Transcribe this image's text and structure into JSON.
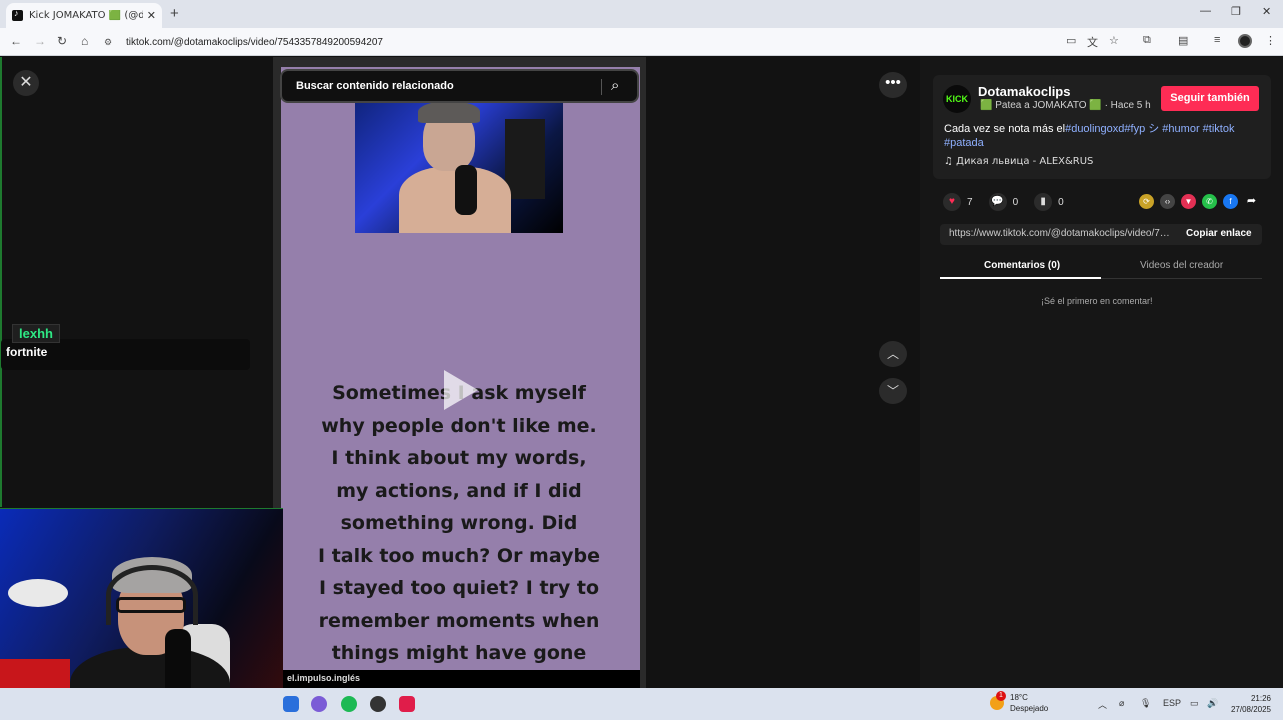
{
  "browser": {
    "tab_title": "Kick JOMAKATO 🟩 (@dota",
    "url": "tiktok.com/@dotamakoclips/video/7543357849200594207"
  },
  "video": {
    "search_placeholder": "Buscar contenido relacionado",
    "text": "Sometimes I ask myself\nwhy people don't like me.\nI think about my words,\nmy actions, and if I did\nsomething wrong. Did\nI talk too much? Or maybe\nI stayed too quiet? I try to\nremember moments when\nthings might have gone",
    "watermark": "el.impulso.inglés"
  },
  "overlay_chat": {
    "user": "lexhh",
    "message": "fortnite"
  },
  "creator": {
    "logo_text": "KICK",
    "name": "Dotamakoclips",
    "subtitle": "🟩 Patea a JOMAKATO 🟩 · Hace 5 h",
    "follow_label": "Seguir también",
    "caption_prefix": "Cada vez se nota más el",
    "caption_tags": "#duolingoxd#fyp シ #humor #tiktok #patada",
    "music": "Дикая львица - ALEX&RUS"
  },
  "stats": {
    "likes": "7",
    "comments": "0",
    "saves": "0"
  },
  "link": {
    "url": "https://www.tiktok.com/@dotamakoclips/video/75...",
    "copy_label": "Copiar enlace"
  },
  "tabs": {
    "comments": "Comentarios (0)",
    "creator_videos": "Videos del creador",
    "empty": "¡Sé el primero en comentar!"
  },
  "taskbar": {
    "temp": "18°C",
    "weather": "Despejado",
    "badge": "1",
    "lang": "ESP",
    "time": "21:26",
    "date": "27/08/2025"
  },
  "colors": {
    "accent": "#fe2c55",
    "video_bg": "#957fab",
    "kick_green": "#53fc18"
  }
}
